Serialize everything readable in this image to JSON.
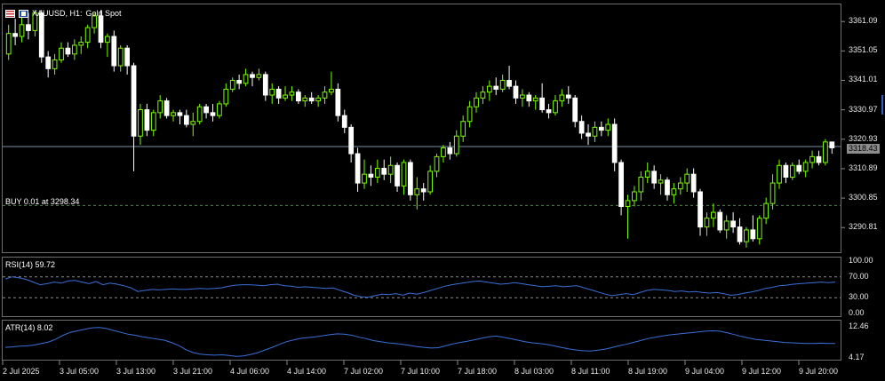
{
  "header": {
    "symbol_text": "XAUUSD, H1:",
    "description": "Gold Spot",
    "icons": [
      "flag-icon-us",
      "flag-icon-eu"
    ]
  },
  "colors": {
    "background": "#000000",
    "bull": "#7CFC00",
    "bear": "#ffffff",
    "grid_line": "#7a8fa6",
    "indicator_line": "#3a6fd8",
    "level_dashed": "#8c8c8c",
    "order_line": "#3c8f3c"
  },
  "main_chart": {
    "bid_price": "3318.43",
    "bid_value": 3318.43,
    "order_label": "BUY 0.01 at 3298.34",
    "order_price": 3298.34,
    "price_ticks": [
      "3361.09",
      "3351.05",
      "3341.01",
      "3330.97",
      "3320.93",
      "3310.89",
      "3300.85",
      "3290.81"
    ]
  },
  "rsi": {
    "label": "RSI(14) 59.72",
    "ticks": [
      "100.00",
      "70.00",
      "30.00",
      "0.00"
    ]
  },
  "atr": {
    "label": "ATR(14) 8.02",
    "ticks": [
      "12.46",
      "4.17"
    ]
  },
  "time_axis": {
    "labels": [
      "2 Jul 2025",
      "3 Jul 05:00",
      "3 Jul 13:00",
      "3 Jul 21:00",
      "4 Jul 06:00",
      "4 Jul 14:00",
      "7 Jul 02:00",
      "7 Jul 10:00",
      "7 Jul 18:00",
      "8 Jul 03:00",
      "8 Jul 11:00",
      "8 Jul 19:00",
      "9 Jul 04:00",
      "9 Jul 12:00",
      "9 Jul 20:00"
    ]
  },
  "chart_data": {
    "type": "candlestick",
    "symbol": "XAUUSD",
    "timeframe": "H1",
    "ylim": [
      3283,
      3366
    ],
    "ohlc": [
      [
        3350,
        3360,
        3348,
        3357
      ],
      [
        3357,
        3362,
        3353,
        3356
      ],
      [
        3356,
        3364,
        3354,
        3360
      ],
      [
        3360,
        3364,
        3355,
        3358
      ],
      [
        3358,
        3365,
        3356,
        3364
      ],
      [
        3364,
        3365,
        3347,
        3349
      ],
      [
        3349,
        3351,
        3342,
        3345
      ],
      [
        3345,
        3350,
        3343,
        3348
      ],
      [
        3348,
        3354,
        3347,
        3352
      ],
      [
        3352,
        3354,
        3349,
        3350
      ],
      [
        3350,
        3355,
        3348,
        3353
      ],
      [
        3353,
        3356,
        3350,
        3354
      ],
      [
        3354,
        3360,
        3352,
        3359
      ],
      [
        3359,
        3364,
        3357,
        3363
      ],
      [
        3363,
        3365,
        3352,
        3354
      ],
      [
        3354,
        3357,
        3349,
        3356
      ],
      [
        3356,
        3358,
        3344,
        3346
      ],
      [
        3346,
        3353,
        3344,
        3352
      ],
      [
        3352,
        3353,
        3343,
        3346
      ],
      [
        3346,
        3347,
        3310,
        3322
      ],
      [
        3322,
        3333,
        3319,
        3331
      ],
      [
        3331,
        3333,
        3322,
        3324
      ],
      [
        3324,
        3331,
        3322,
        3330
      ],
      [
        3330,
        3336,
        3328,
        3334
      ],
      [
        3334,
        3335,
        3328,
        3329
      ],
      [
        3329,
        3331,
        3327,
        3330
      ],
      [
        3330,
        3331,
        3326,
        3329
      ],
      [
        3329,
        3331,
        3325,
        3326
      ],
      [
        3326,
        3330,
        3322,
        3327
      ],
      [
        3327,
        3333,
        3326,
        3332
      ],
      [
        3332,
        3333,
        3328,
        3330
      ],
      [
        3330,
        3333,
        3327,
        3329
      ],
      [
        3329,
        3334,
        3328,
        3333
      ],
      [
        3333,
        3340,
        3332,
        3338
      ],
      [
        3338,
        3342,
        3337,
        3341
      ],
      [
        3341,
        3343,
        3338,
        3340
      ],
      [
        3340,
        3345,
        3339,
        3343
      ],
      [
        3343,
        3344,
        3339,
        3342
      ],
      [
        3342,
        3345,
        3341,
        3343
      ],
      [
        3343,
        3344,
        3334,
        3336
      ],
      [
        3336,
        3340,
        3333,
        3338
      ],
      [
        3338,
        3339,
        3333,
        3335
      ],
      [
        3335,
        3339,
        3334,
        3336
      ],
      [
        3336,
        3339,
        3334,
        3337
      ],
      [
        3337,
        3338,
        3333,
        3334
      ],
      [
        3334,
        3336,
        3332,
        3335
      ],
      [
        3335,
        3337,
        3333,
        3334
      ],
      [
        3334,
        3336,
        3332,
        3335
      ],
      [
        3335,
        3339,
        3333,
        3337
      ],
      [
        3337,
        3344,
        3336,
        3338
      ],
      [
        3338,
        3340,
        3327,
        3329
      ],
      [
        3329,
        3331,
        3323,
        3325
      ],
      [
        3325,
        3326,
        3313,
        3316
      ],
      [
        3316,
        3318,
        3303,
        3306
      ],
      [
        3306,
        3314,
        3304,
        3309
      ],
      [
        3309,
        3312,
        3305,
        3308
      ],
      [
        3308,
        3314,
        3306,
        3311
      ],
      [
        3311,
        3314,
        3307,
        3309
      ],
      [
        3309,
        3315,
        3306,
        3312
      ],
      [
        3312,
        3313,
        3303,
        3305
      ],
      [
        3305,
        3314,
        3302,
        3313
      ],
      [
        3313,
        3314,
        3300,
        3302
      ],
      [
        3302,
        3308,
        3297,
        3304
      ],
      [
        3304,
        3306,
        3300,
        3303
      ],
      [
        3303,
        3312,
        3302,
        3310
      ],
      [
        3310,
        3316,
        3308,
        3315
      ],
      [
        3315,
        3319,
        3313,
        3318
      ],
      [
        3318,
        3320,
        3314,
        3316
      ],
      [
        3316,
        3324,
        3315,
        3322
      ],
      [
        3322,
        3329,
        3320,
        3327
      ],
      [
        3327,
        3334,
        3325,
        3332
      ],
      [
        3332,
        3337,
        3330,
        3335
      ],
      [
        3335,
        3339,
        3333,
        3337
      ],
      [
        3337,
        3341,
        3334,
        3339
      ],
      [
        3339,
        3342,
        3336,
        3338
      ],
      [
        3338,
        3343,
        3337,
        3341
      ],
      [
        3341,
        3346,
        3338,
        3339
      ],
      [
        3339,
        3341,
        3333,
        3335
      ],
      [
        3335,
        3338,
        3332,
        3336
      ],
      [
        3336,
        3337,
        3332,
        3334
      ],
      [
        3334,
        3336,
        3331,
        3335
      ],
      [
        3335,
        3340,
        3330,
        3331
      ],
      [
        3331,
        3333,
        3328,
        3330
      ],
      [
        3330,
        3336,
        3329,
        3334
      ],
      [
        3334,
        3338,
        3332,
        3336
      ],
      [
        3336,
        3339,
        3333,
        3335
      ],
      [
        3335,
        3336,
        3325,
        3327
      ],
      [
        3327,
        3329,
        3321,
        3323
      ],
      [
        3323,
        3326,
        3319,
        3322
      ],
      [
        3322,
        3327,
        3320,
        3325
      ],
      [
        3325,
        3327,
        3322,
        3324
      ],
      [
        3324,
        3328,
        3322,
        3326
      ],
      [
        3326,
        3328,
        3310,
        3313
      ],
      [
        3313,
        3314,
        3295,
        3298
      ],
      [
        3298,
        3302,
        3287,
        3300
      ],
      [
        3300,
        3305,
        3298,
        3303
      ],
      [
        3303,
        3310,
        3300,
        3308
      ],
      [
        3308,
        3313,
        3306,
        3310
      ],
      [
        3310,
        3312,
        3304,
        3306
      ],
      [
        3306,
        3309,
        3302,
        3307
      ],
      [
        3307,
        3308,
        3300,
        3302
      ],
      [
        3302,
        3306,
        3299,
        3304
      ],
      [
        3304,
        3308,
        3302,
        3306
      ],
      [
        3306,
        3311,
        3303,
        3309
      ],
      [
        3309,
        3311,
        3301,
        3303
      ],
      [
        3303,
        3304,
        3288,
        3291
      ],
      [
        3291,
        3296,
        3288,
        3294
      ],
      [
        3294,
        3299,
        3291,
        3296
      ],
      [
        3296,
        3297,
        3289,
        3290
      ],
      [
        3290,
        3295,
        3287,
        3293
      ],
      [
        3293,
        3296,
        3289,
        3291
      ],
      [
        3291,
        3294,
        3285,
        3286
      ],
      [
        3286,
        3291,
        3284,
        3290
      ],
      [
        3290,
        3295,
        3286,
        3287
      ],
      [
        3287,
        3295,
        3285,
        3294
      ],
      [
        3294,
        3301,
        3292,
        3299
      ],
      [
        3299,
        3309,
        3297,
        3306
      ],
      [
        3306,
        3314,
        3304,
        3312
      ],
      [
        3312,
        3313,
        3306,
        3308
      ],
      [
        3308,
        3313,
        3307,
        3312
      ],
      [
        3312,
        3314,
        3309,
        3310
      ],
      [
        3310,
        3314,
        3308,
        3313
      ],
      [
        3313,
        3317,
        3311,
        3315
      ],
      [
        3315,
        3317,
        3312,
        3313
      ],
      [
        3313,
        3321,
        3312,
        3320
      ],
      [
        3320,
        3320,
        3316,
        3318
      ]
    ],
    "rsi": [
      66,
      70,
      68,
      65,
      60,
      55,
      57,
      60,
      58,
      62,
      63,
      60,
      57,
      61,
      55,
      58,
      56,
      53,
      49,
      42,
      44,
      46,
      45,
      46,
      47,
      46,
      46,
      47,
      48,
      47,
      48,
      49,
      52,
      54,
      55,
      55,
      54,
      53,
      55,
      56,
      53,
      52,
      50,
      51,
      50,
      49,
      48,
      49,
      44,
      40,
      35,
      32,
      31,
      34,
      37,
      36,
      38,
      35,
      39,
      37,
      40,
      44,
      48,
      52,
      55,
      57,
      59,
      61,
      62,
      60,
      58,
      56,
      57,
      59,
      57,
      55,
      53,
      51,
      52,
      53,
      51,
      52,
      53,
      49,
      45,
      41,
      37,
      34,
      36,
      38,
      36,
      40,
      44,
      46,
      45,
      44,
      42,
      43,
      41,
      42,
      40,
      39,
      40,
      38,
      35,
      36,
      39,
      41,
      44,
      48,
      50,
      53,
      54,
      56,
      57,
      58,
      59,
      60,
      59,
      60
    ],
    "atr": [
      7.0,
      7.1,
      7.3,
      7.4,
      7.6,
      8.0,
      8.4,
      9.2,
      10.2,
      11.0,
      11.4,
      11.8,
      12.2,
      12.3,
      12.0,
      11.5,
      11.0,
      10.5,
      10.2,
      9.8,
      9.5,
      9.2,
      8.9,
      8.3,
      7.5,
      6.4,
      5.6,
      5.2,
      5.0,
      4.9,
      5.0,
      4.8,
      4.6,
      4.7,
      5.1,
      5.6,
      6.3,
      7.0,
      7.8,
      8.5,
      9.0,
      9.4,
      9.6,
      9.8,
      10.1,
      10.4,
      10.6,
      10.5,
      10.2,
      9.7,
      9.3,
      8.8,
      8.5,
      8.2,
      8.0,
      7.8,
      7.5,
      7.2,
      7.0,
      6.8,
      6.9,
      7.4,
      7.9,
      8.3,
      8.6,
      9.0,
      9.4,
      9.8,
      10.0,
      9.7,
      9.3,
      8.9,
      8.5,
      8.2,
      8.0,
      7.8,
      7.4,
      7.0,
      6.6,
      6.3,
      6.1,
      6.0,
      6.2,
      6.5,
      6.9,
      7.4,
      7.8,
      8.3,
      8.8,
      9.3,
      9.7,
      10.0,
      10.3,
      10.5,
      10.7,
      10.9,
      11.1,
      11.3,
      11.4,
      11.3,
      10.9,
      10.4,
      9.9,
      9.5,
      9.1,
      8.9,
      8.7,
      8.5,
      8.3,
      8.2,
      8.1,
      8.0,
      8.0,
      8.1,
      8.0,
      8.0
    ]
  }
}
